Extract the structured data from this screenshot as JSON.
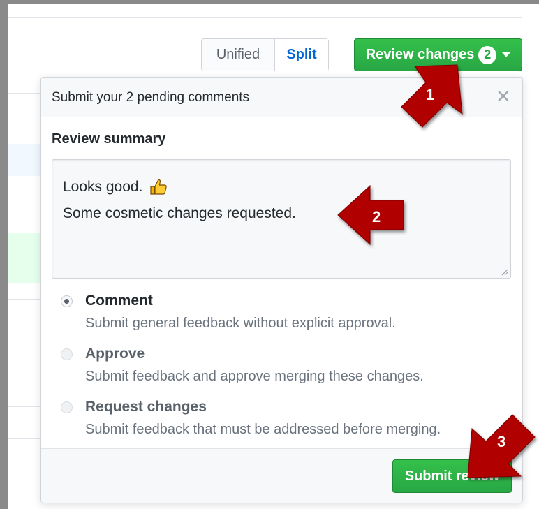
{
  "view_toggle": {
    "unified_label": "Unified",
    "split_label": "Split",
    "selected": "Split"
  },
  "review_button": {
    "label": "Review changes",
    "count": "2"
  },
  "popover": {
    "title": "Submit your 2 pending comments",
    "summary_label": "Review summary",
    "summary_lines": [
      "Looks good.",
      "Some cosmetic changes requested."
    ],
    "summary_emoji": "thumbs-up-icon",
    "options": [
      {
        "title": "Comment",
        "description": "Submit general feedback without explicit approval.",
        "checked": true
      },
      {
        "title": "Approve",
        "description": "Submit feedback and approve merging these changes.",
        "checked": false
      },
      {
        "title": "Request changes",
        "description": "Submit feedback that must be addressed before merging.",
        "checked": false
      }
    ],
    "submit_label": "Submit review"
  },
  "annotations": {
    "step1": "1",
    "step2": "2",
    "step3": "3",
    "arrow_color": "#b00000"
  },
  "colors": {
    "primary_green": "#28a745",
    "link_blue": "#0366d6"
  }
}
